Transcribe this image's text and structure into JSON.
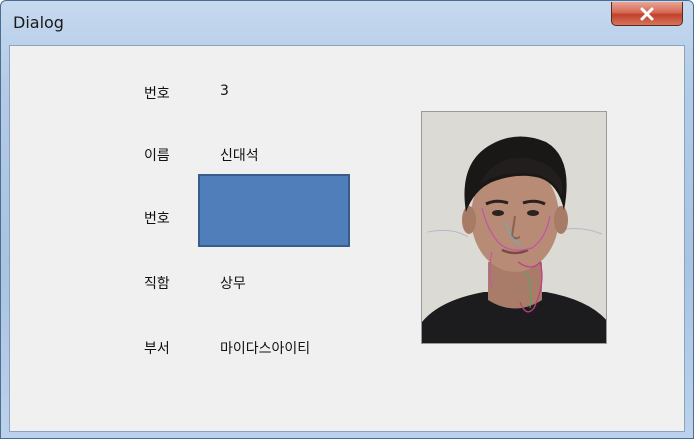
{
  "window": {
    "title": "Dialog"
  },
  "icons": {
    "close": "close-icon"
  },
  "fields": [
    {
      "label": "번호",
      "value": "3"
    },
    {
      "label": "이름",
      "value": "신대석"
    },
    {
      "label": "번호",
      "value": ""
    },
    {
      "label": "직함",
      "value": "상무"
    },
    {
      "label": "부서",
      "value": "마이다스아이티"
    }
  ],
  "colors": {
    "field_box_fill": "#4f7ebb",
    "field_box_border": "#385d8a",
    "close_button": "#c2412a"
  }
}
